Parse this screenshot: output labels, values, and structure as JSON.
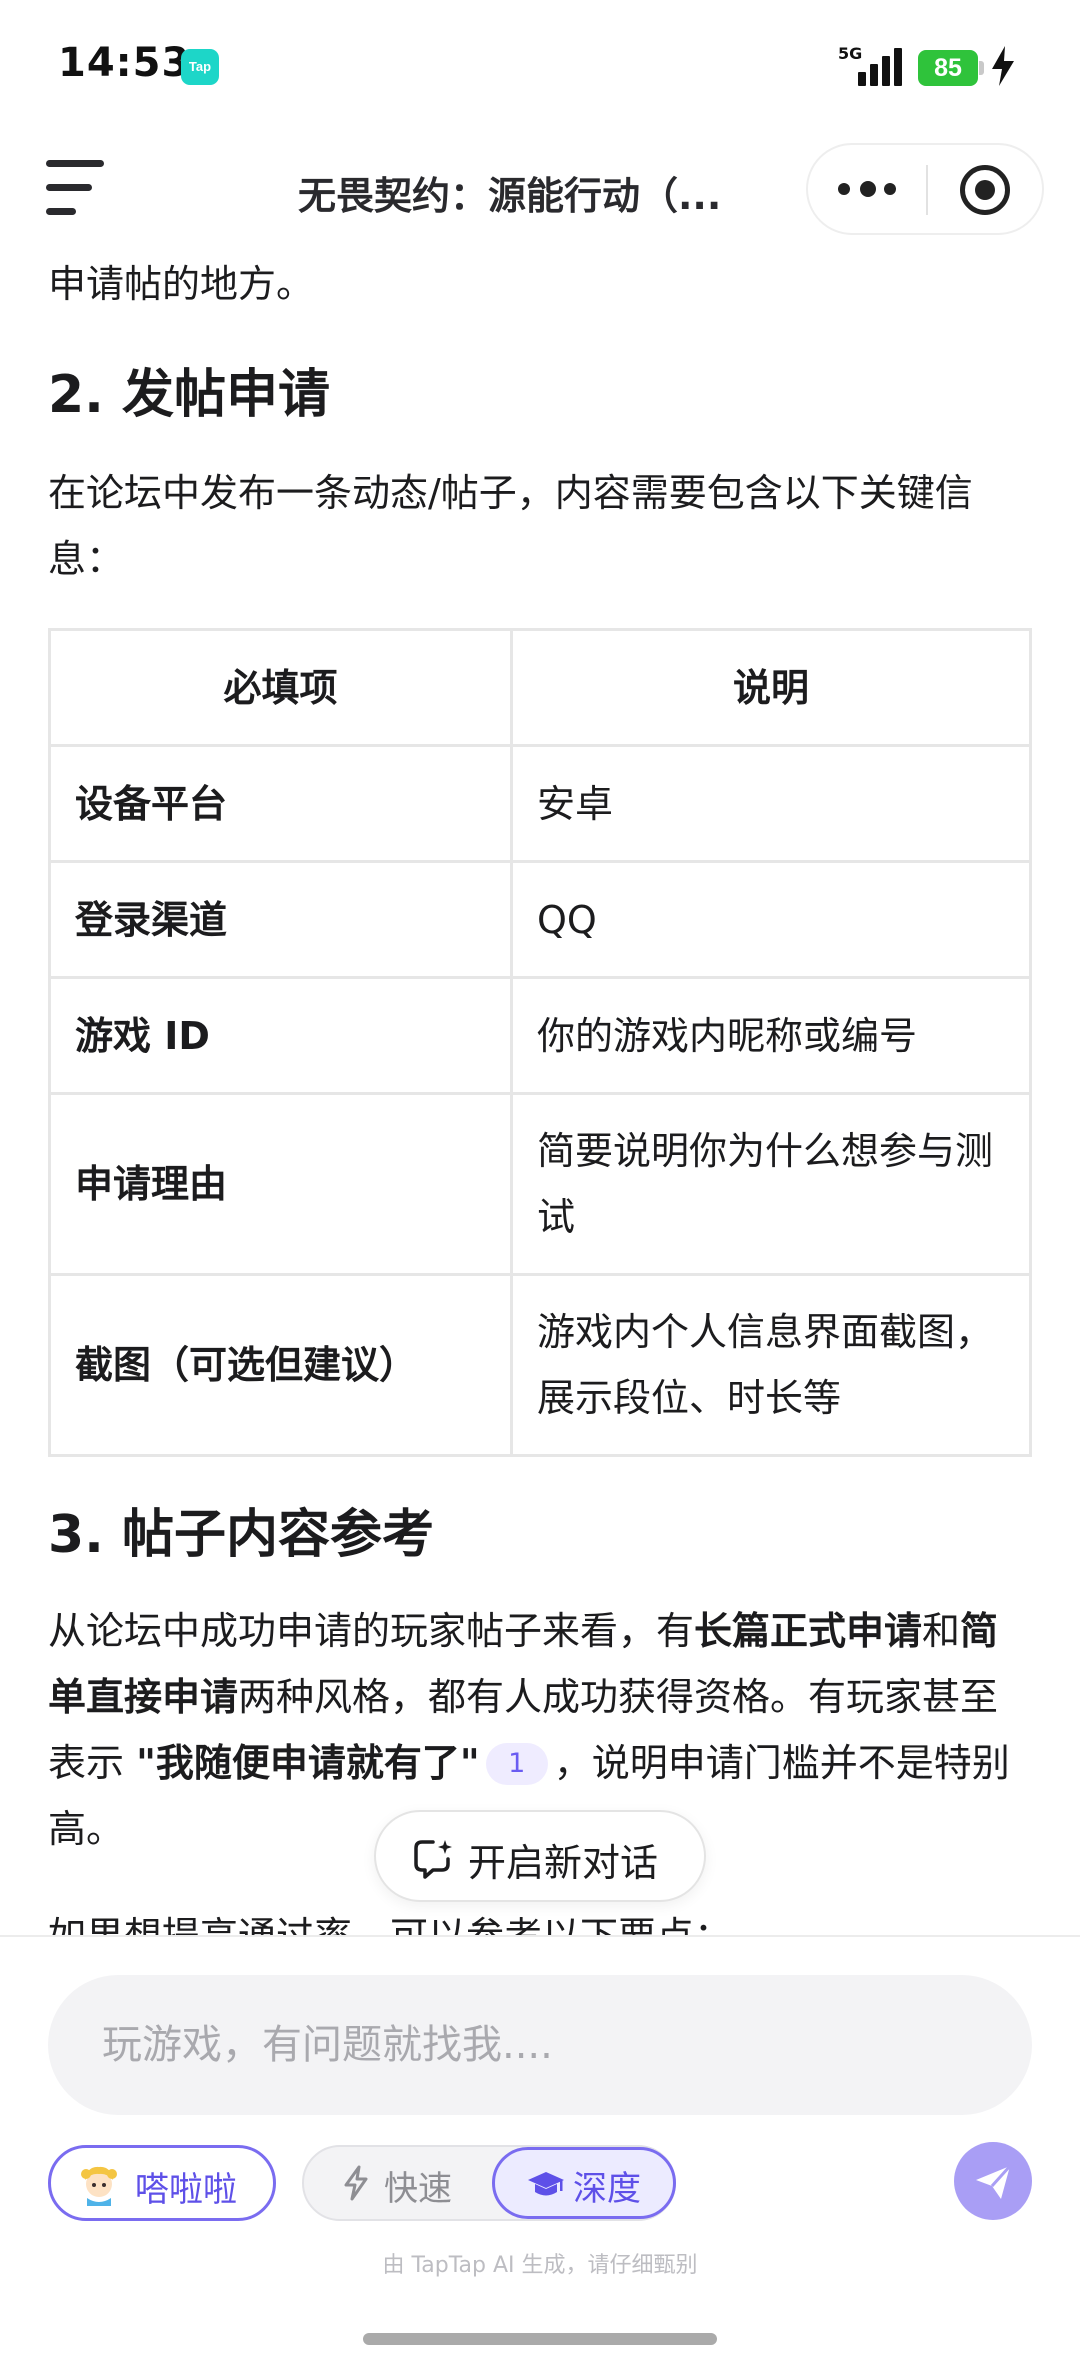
{
  "status_bar": {
    "time": "14:53",
    "app_badge": "Tap",
    "network": "5G",
    "battery_level": "85"
  },
  "nav": {
    "title": "无畏契约：源能行动（..."
  },
  "content": {
    "top_fragment": "申请帖的地方。",
    "section2_heading": "2. 发帖申请",
    "section2_intro": "在论坛中发布一条动态/帖子，内容需要包含以下关键信息：",
    "table": {
      "headers": [
        "必填项",
        "说明"
      ],
      "rows": [
        {
          "field": "设备平台",
          "desc": "安卓"
        },
        {
          "field": "登录渠道",
          "desc": "QQ"
        },
        {
          "field": "游戏 ID",
          "desc": "你的游戏内昵称或编号"
        },
        {
          "field": "申请理由",
          "desc": "简要说明你为什么想参与测试"
        },
        {
          "field": "截图（可选但建议）",
          "desc": "游戏内个人信息界面截图，展示段位、时长等"
        }
      ]
    },
    "section3_heading": "3. 帖子内容参考",
    "section3_body": {
      "part1": "从论坛中成功申请的玩家帖子来看，有",
      "bold1": "长篇正式申请",
      "part2": "和",
      "bold2": "简单直接申请",
      "part3": "两种风格，都有人成功获得资格。有玩家甚至表示 ",
      "quote": "\"我随便申请就有了\"",
      "citation": "1",
      "part4": "，说明申请门槛并不是特别高。"
    },
    "section3_tail": "如果想提高通过率，可以参考以下要点："
  },
  "new_chat": {
    "label": "开启新对话"
  },
  "composer": {
    "placeholder": "玩游戏，有问题就找我....",
    "persona_label": "嗒啦啦",
    "mode_fast_label": "快速",
    "mode_deep_label": "深度",
    "selected_mode": "深度",
    "disclaimer": "由 TapTap AI 生成，请仔细甄别"
  },
  "colors": {
    "accent": "#7a6cf0",
    "accent_soft": "#ecebff",
    "send_button": "#a99ef5",
    "battery": "#2fc33b",
    "tap_badge": "#1dd6c8"
  },
  "icons": [
    "menu-icon",
    "more-dots-icon",
    "close-circle-icon",
    "new-chat-icon",
    "persona-avatar-icon",
    "lightning-icon",
    "graduation-cap-icon",
    "send-icon",
    "charging-icon"
  ]
}
